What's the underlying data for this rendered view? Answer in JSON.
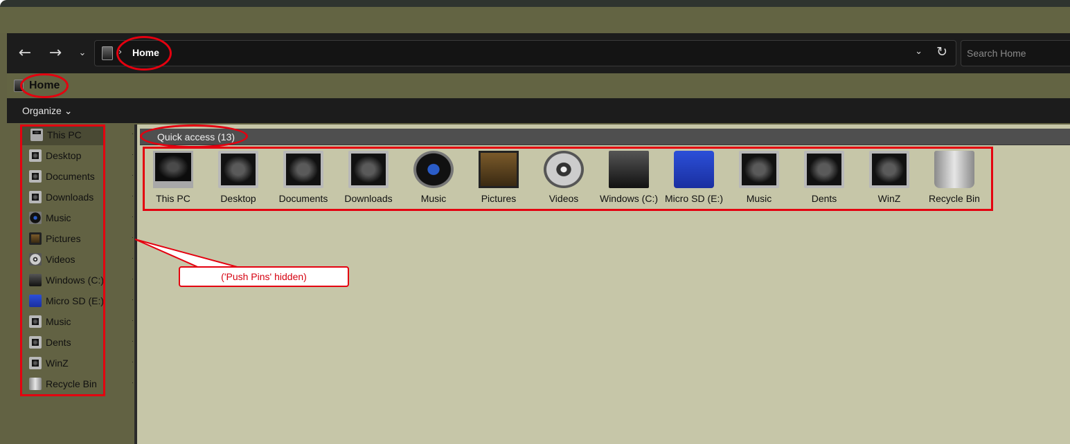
{
  "navigation": {
    "back_glyph": "←",
    "forward_glyph": "→",
    "recent_glyph": "⌄",
    "address_chevron": "›",
    "address_text": "Home",
    "address_dropdown_glyph": "⌄",
    "refresh_glyph": "↻",
    "search_placeholder": "Search Home"
  },
  "title": "Home",
  "commands": {
    "organize_label": "Organize ⌄"
  },
  "nav_pane": {
    "items": [
      {
        "label": "This PC",
        "icon": "monitor-icon"
      },
      {
        "label": "Desktop",
        "icon": "desktop-icon"
      },
      {
        "label": "Documents",
        "icon": "documents-icon"
      },
      {
        "label": "Downloads",
        "icon": "downloads-icon"
      },
      {
        "label": "Music",
        "icon": "music-icon"
      },
      {
        "label": "Pictures",
        "icon": "pictures-icon"
      },
      {
        "label": "Videos",
        "icon": "videos-icon"
      },
      {
        "label": "Windows (C:)",
        "icon": "drive-icon"
      },
      {
        "label": "Micro SD (E:)",
        "icon": "sd-card-icon"
      },
      {
        "label": "Music",
        "icon": "folder-icon"
      },
      {
        "label": "Dents",
        "icon": "folder-icon"
      },
      {
        "label": "WinZ",
        "icon": "folder-icon"
      },
      {
        "label": "Recycle Bin",
        "icon": "recycle-bin-icon"
      }
    ],
    "pin_glyph": "··"
  },
  "content": {
    "group_header": "Quick access (13)",
    "tiles": [
      {
        "label": "This PC",
        "icon": "monitor-icon"
      },
      {
        "label": "Desktop",
        "icon": "desktop-icon"
      },
      {
        "label": "Documents",
        "icon": "documents-icon"
      },
      {
        "label": "Downloads",
        "icon": "downloads-icon"
      },
      {
        "label": "Music",
        "icon": "music-icon"
      },
      {
        "label": "Pictures",
        "icon": "pictures-icon"
      },
      {
        "label": "Videos",
        "icon": "videos-icon"
      },
      {
        "label": "Windows (C:)",
        "icon": "drive-icon"
      },
      {
        "label": "Micro SD (E:)",
        "icon": "sd-card-icon"
      },
      {
        "label": "Music",
        "icon": "folder-icon"
      },
      {
        "label": "Dents",
        "icon": "folder-icon"
      },
      {
        "label": "WinZ",
        "icon": "folder-icon"
      },
      {
        "label": "Recycle Bin",
        "icon": "recycle-bin-icon"
      }
    ]
  },
  "annotation": {
    "callout_text": "('Push Pins' hidden)"
  },
  "colors": {
    "annotation_red": "#e4000f",
    "window_olive": "#636443",
    "content_bg": "#c6c6a8",
    "dark_bar": "#1c1c1c"
  }
}
